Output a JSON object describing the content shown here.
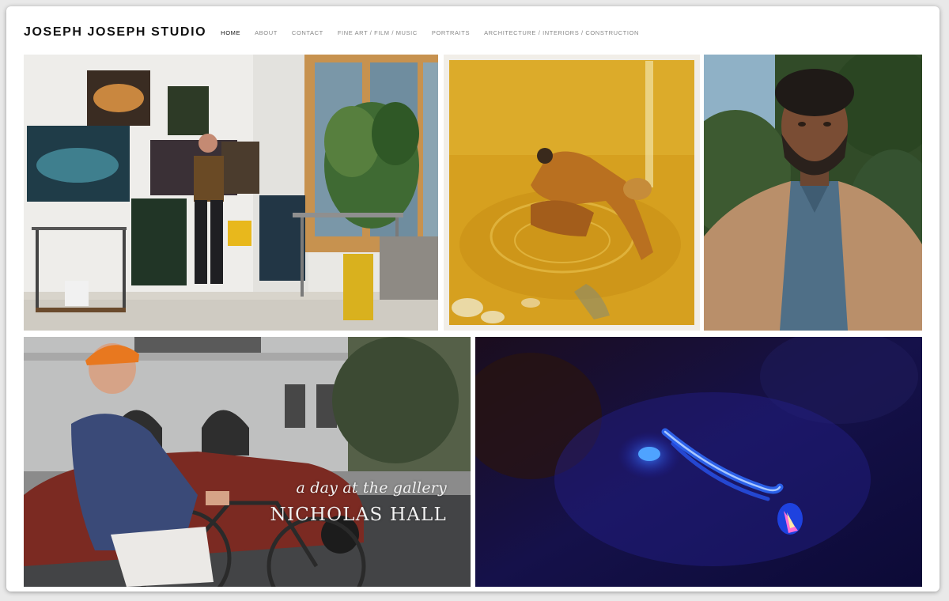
{
  "site": {
    "title": "JOSEPH JOSEPH STUDIO"
  },
  "nav": {
    "items": [
      {
        "label": "HOME",
        "active": true
      },
      {
        "label": "ABOUT",
        "active": false
      },
      {
        "label": "CONTACT",
        "active": false
      },
      {
        "label": "FINE ART / FILM / MUSIC",
        "active": false
      },
      {
        "label": "PORTRAITS",
        "active": false
      },
      {
        "label": "ARCHITECTURE / INTERIORS / CONSTRUCTION",
        "active": false
      }
    ]
  },
  "gallery": {
    "video_tile": {
      "line1": "a day at the gallery",
      "line2": "NICHOLAS HALL"
    }
  },
  "colors": {
    "text_primary": "#111111",
    "nav_inactive": "#888888",
    "background": "#ffffff"
  }
}
